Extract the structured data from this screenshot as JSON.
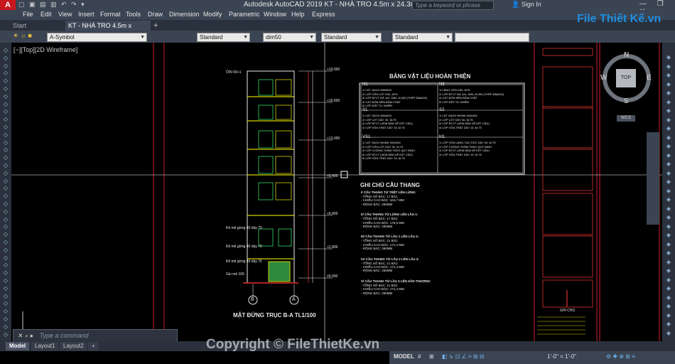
{
  "app": {
    "window_title": "Autodesk AutoCAD 2019    KT - NHÀ TRO 4.5m x 24.3m.dwg",
    "logo": "A",
    "search_placeholder": "Type a keyword or phrase",
    "signin": "Sign In",
    "window_controls": "— ❐ ✕"
  },
  "menu": [
    "File",
    "Edit",
    "View",
    "Insert",
    "Format",
    "Tools",
    "Draw",
    "Dimension",
    "Modify",
    "Parametric",
    "Window",
    "Help",
    "Express"
  ],
  "tabs": {
    "start": "Start",
    "drawing": "KT - NHÀ TRO 4.5m x 24.3m*",
    "add": "+"
  },
  "toolbar": {
    "layer": "A-Symbol",
    "text_style": "Standard",
    "dim_style": "dim50",
    "table_style": "Standard",
    "mleader_style": "Standard"
  },
  "viewport": {
    "label": "[−][Top][2D Wireframe]"
  },
  "navcube": {
    "n": "N",
    "s": "S",
    "w": "W",
    "e": "E",
    "top": "TOP",
    "wcs": "WCS"
  },
  "drawing": {
    "table_title": "BẢNG VẬT LIỆU HOÀN THIỆN",
    "stair_title": "GHI CHÚ CẦU THANG",
    "elevation_title": "MẶT ĐỨNG TRỤC B-A TL1/100",
    "axis_b": "B",
    "axis_a": "A",
    "levels": [
      "+19.000",
      "+16.500",
      "+13.000",
      "+9.400",
      "+6.800",
      "+2.800",
      "±0.000"
    ],
    "cells": [
      {
        "code": "N1",
        "lines": [
          "1/ LÁT GẠCH 600x600",
          "2/ LỚP VỮA LÓT D30, M75",
          "3/ LỚP BTCT ĐÁ 1x2, D80, M.300 (THÉP Ø6a200)",
          "4/ CÁT ĐỔN NỀN ĐẦM CHẶT",
          "5/ LỚP ĐẤT TỰ NHIÊN"
        ]
      },
      {
        "code": "N2",
        "lines": [
          "1/ LÁNG VỮA D30, M75",
          "2/ LỚP BTCT ĐÁ 1x2, D80, M.300 (THÉP Ø6a200)",
          "4/ CÁT ĐỔN NỀN ĐẦM CHẶT",
          "5/ LỚP ĐẤT TỰ NHIÊN"
        ]
      },
      {
        "code": "S1",
        "lines": [
          "1/ LÁT GẠCH 600x600",
          "2/ LỚP LÓT DÀY 30, M.75",
          "3/ LỚP BTCT (XEM BẢN VẼ KẾT CẤU)",
          "4/ LỚP VỮA TRÁT DÀY 15, M.75"
        ]
      },
      {
        "code": "S2",
        "lines": [
          "1/ LÁT GẠCH NHÁM 400x400",
          "2/ LỚP LÓT DÀY 30, M.75",
          "3/ LỚP BTCT (XEM BẢN VẼ KẾT CẤU)",
          "4/ LỚP VỮA TRÁT DÀY 15, M.75"
        ]
      },
      {
        "code": "VS1",
        "lines": [
          "1/ LÁT GẠCH NHÁM 300x300",
          "2/ LỚP VỮA LÓT DÀY 30, M.75",
          "3/ LỚP CHỐNG THẤM THEO QUY ĐỊNH",
          "4/ LỚP BTCT (XEM BẢN VẼ KẾT CẤU)",
          "5/ LỚP VỮA TRÁT DÀY 15, M.75"
        ]
      },
      {
        "code": "M1",
        "lines": [
          "1/ LỚP VỮA LÁNG TẠO DỐC DÀY 30, M.75",
          "2/ LỚP CHỐNG THẤM THEO QUY ĐỊNH",
          "3/ LỚP BTCT (XEM BẢN VẼ KẾT CẤU)",
          "4/ LỚP VỮA TRÁT DÀY 15, M.75"
        ]
      }
    ],
    "stairs": [
      {
        "head": "I/ CẦU THANG TỪ TRỆT LÊN LỬNG:",
        "lines": [
          "- TỔNG SỐ BẬC: 17 BẬC",
          "- CHIỀU CAO BẬC: 164,7 MM",
          "- RỘNG BẬC: 260MM"
        ]
      },
      {
        "head": "II/ CẦU THANG TỪ LỬNG LÊN LẦU 1:",
        "lines": [
          "- TỔNG SỐ BẬC: 17 BẬC",
          "- CHIỀU CAO BẬC: 176,5 MM",
          "- RỘNG BẬC: 260MM"
        ]
      },
      {
        "head": "III/ CẦU THANG TỪ LẦU 1 LÊN LẦU 2:",
        "lines": [
          "- TỔNG SỐ BẬC: 21 BẬC",
          "- CHIỀU CAO BẬC: 171,4 MM",
          "- RỘNG BẬC: 260MM"
        ]
      },
      {
        "head": "IV/ CẦU THANG TỪ LẦU 2 LÊN LẦU 3:",
        "lines": [
          "- TỔNG SỐ BẬC: 21 BẬC",
          "- CHIỀU CAO BẬC: 171,4 MM",
          "- RỘNG BẬC: 260MM"
        ]
      },
      {
        "head": "V/ CẦU THANG TỪ LẦU 3 LÊN SÂN THƯỢNG:",
        "lines": [
          "- TỔNG SỐ BẬC: 21 BẬC",
          "- CHIỀU CAO BẬC: 171,4 MM",
          "- RỘNG BẬC: 260MM"
        ]
      }
    ],
    "side_notes": [
      "Ô/N 00+1",
      "Kê mê gờng 40 dày 70",
      "Kê mê gờng 40 dày 70",
      "Kê mê gờng 40 dày 70",
      "Gio mê 106"
    ],
    "right_label": "GHI CHÚ"
  },
  "command": {
    "placeholder": "Type a command",
    "prefix": "✕ ⌕ ▸"
  },
  "layout_tabs": [
    "Model",
    "Layout1",
    "Layout2",
    "+"
  ],
  "status": {
    "model": "MODEL",
    "scale": "1'-0\" = 1'-0\"",
    "grid": "#",
    "snap": "⊞"
  },
  "watermark": {
    "copyright": "Copyright © FileThietKe.vn",
    "logo": "File Thiết Kế.vn"
  }
}
